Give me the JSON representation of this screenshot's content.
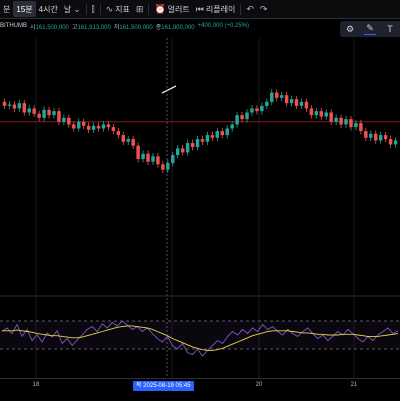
{
  "toolbar": {
    "items": [
      {
        "label": "분",
        "active": false
      },
      {
        "label": "15분",
        "active": true
      },
      {
        "label": "4시간",
        "active": false
      },
      {
        "label": "날",
        "active": false
      }
    ],
    "candle_icon": "candle-chart-icon",
    "indicators_label": "지표",
    "alerts_label": "얼러트",
    "replay_label": "리플레이"
  },
  "legend": {
    "symbol": "BITHUMB",
    "open_label": "시",
    "open": "161,500,000",
    "high_label": "고",
    "high": "161,913,000",
    "low_label": "저",
    "low": "161,500,000",
    "close_label": "종",
    "close": "161,900,000",
    "change": "+400,000 (+0.25%)"
  },
  "colors": {
    "background": "#000000",
    "up": "#26a69a",
    "down": "#ef5350",
    "grid": "#161a22",
    "price_line": "#8b1a1a",
    "rsi_line": "#7e57c2",
    "rsi_ma": "#e8d44d",
    "crosshair": "#787b86",
    "accent": "#2962ff"
  },
  "time_axis": {
    "ticks": [
      "18",
      "19",
      "20",
      "21"
    ],
    "crosshair_label": "목 2025-08-19   05:45"
  },
  "chart_data": {
    "type": "candlestick",
    "series": [
      {
        "name": "price",
        "values": [
          {
            "t": 1,
            "o": 0.55,
            "c": 0.52
          },
          {
            "t": 2,
            "o": 0.52,
            "c": 0.53
          },
          {
            "t": 3,
            "o": 0.53,
            "c": 0.5
          },
          {
            "t": 4,
            "o": 0.5,
            "c": 0.54
          },
          {
            "t": 5,
            "o": 0.54,
            "c": 0.47
          },
          {
            "t": 6,
            "o": 0.47,
            "c": 0.5
          },
          {
            "t": 7,
            "o": 0.5,
            "c": 0.46
          },
          {
            "t": 8,
            "o": 0.46,
            "c": 0.43
          },
          {
            "t": 9,
            "o": 0.43,
            "c": 0.49
          },
          {
            "t": 10,
            "o": 0.49,
            "c": 0.45
          },
          {
            "t": 11,
            "o": 0.45,
            "c": 0.48
          },
          {
            "t": 12,
            "o": 0.48,
            "c": 0.4
          },
          {
            "t": 13,
            "o": 0.4,
            "c": 0.43
          },
          {
            "t": 14,
            "o": 0.43,
            "c": 0.38
          },
          {
            "t": 15,
            "o": 0.38,
            "c": 0.35
          },
          {
            "t": 16,
            "o": 0.35,
            "c": 0.4
          },
          {
            "t": 17,
            "o": 0.4,
            "c": 0.37
          },
          {
            "t": 18,
            "o": 0.37,
            "c": 0.34
          },
          {
            "t": 19,
            "o": 0.34,
            "c": 0.37
          },
          {
            "t": 20,
            "o": 0.37,
            "c": 0.35
          },
          {
            "t": 21,
            "o": 0.35,
            "c": 0.38
          },
          {
            "t": 22,
            "o": 0.38,
            "c": 0.36
          },
          {
            "t": 23,
            "o": 0.36,
            "c": 0.33
          },
          {
            "t": 24,
            "o": 0.33,
            "c": 0.3
          },
          {
            "t": 25,
            "o": 0.3,
            "c": 0.25
          },
          {
            "t": 26,
            "o": 0.25,
            "c": 0.27
          },
          {
            "t": 27,
            "o": 0.27,
            "c": 0.22
          },
          {
            "t": 28,
            "o": 0.22,
            "c": 0.12
          },
          {
            "t": 29,
            "o": 0.12,
            "c": 0.16
          },
          {
            "t": 30,
            "o": 0.16,
            "c": 0.1
          },
          {
            "t": 31,
            "o": 0.1,
            "c": 0.14
          },
          {
            "t": 32,
            "o": 0.14,
            "c": 0.08
          },
          {
            "t": 33,
            "o": 0.08,
            "c": 0.04
          },
          {
            "t": 34,
            "o": 0.04,
            "c": 0.09
          },
          {
            "t": 35,
            "o": 0.09,
            "c": 0.15
          },
          {
            "t": 36,
            "o": 0.15,
            "c": 0.2
          },
          {
            "t": 37,
            "o": 0.2,
            "c": 0.17
          },
          {
            "t": 38,
            "o": 0.17,
            "c": 0.24
          },
          {
            "t": 39,
            "o": 0.24,
            "c": 0.21
          },
          {
            "t": 40,
            "o": 0.21,
            "c": 0.27
          },
          {
            "t": 41,
            "o": 0.27,
            "c": 0.25
          },
          {
            "t": 42,
            "o": 0.25,
            "c": 0.3
          },
          {
            "t": 43,
            "o": 0.3,
            "c": 0.28
          },
          {
            "t": 44,
            "o": 0.28,
            "c": 0.33
          },
          {
            "t": 45,
            "o": 0.33,
            "c": 0.3
          },
          {
            "t": 46,
            "o": 0.3,
            "c": 0.35
          },
          {
            "t": 47,
            "o": 0.35,
            "c": 0.38
          },
          {
            "t": 48,
            "o": 0.38,
            "c": 0.45
          },
          {
            "t": 49,
            "o": 0.45,
            "c": 0.42
          },
          {
            "t": 50,
            "o": 0.42,
            "c": 0.47
          },
          {
            "t": 51,
            "o": 0.47,
            "c": 0.5
          },
          {
            "t": 52,
            "o": 0.5,
            "c": 0.48
          },
          {
            "t": 53,
            "o": 0.48,
            "c": 0.52
          },
          {
            "t": 54,
            "o": 0.52,
            "c": 0.55
          },
          {
            "t": 55,
            "o": 0.55,
            "c": 0.62
          },
          {
            "t": 56,
            "o": 0.62,
            "c": 0.58
          },
          {
            "t": 57,
            "o": 0.58,
            "c": 0.6
          },
          {
            "t": 58,
            "o": 0.6,
            "c": 0.54
          },
          {
            "t": 59,
            "o": 0.54,
            "c": 0.57
          },
          {
            "t": 60,
            "o": 0.57,
            "c": 0.52
          },
          {
            "t": 61,
            "o": 0.52,
            "c": 0.55
          },
          {
            "t": 62,
            "o": 0.55,
            "c": 0.5
          },
          {
            "t": 63,
            "o": 0.5,
            "c": 0.45
          },
          {
            "t": 64,
            "o": 0.45,
            "c": 0.48
          },
          {
            "t": 65,
            "o": 0.48,
            "c": 0.44
          },
          {
            "t": 66,
            "o": 0.44,
            "c": 0.47
          },
          {
            "t": 67,
            "o": 0.47,
            "c": 0.4
          },
          {
            "t": 68,
            "o": 0.4,
            "c": 0.43
          },
          {
            "t": 69,
            "o": 0.43,
            "c": 0.38
          },
          {
            "t": 70,
            "o": 0.38,
            "c": 0.42
          },
          {
            "t": 71,
            "o": 0.42,
            "c": 0.36
          },
          {
            "t": 72,
            "o": 0.36,
            "c": 0.39
          },
          {
            "t": 73,
            "o": 0.39,
            "c": 0.33
          },
          {
            "t": 74,
            "o": 0.33,
            "c": 0.28
          },
          {
            "t": 75,
            "o": 0.28,
            "c": 0.31
          },
          {
            "t": 76,
            "o": 0.31,
            "c": 0.26
          },
          {
            "t": 77,
            "o": 0.26,
            "c": 0.3
          },
          {
            "t": 78,
            "o": 0.3,
            "c": 0.27
          },
          {
            "t": 79,
            "o": 0.27,
            "c": 0.23
          },
          {
            "t": 80,
            "o": 0.23,
            "c": 0.26
          }
        ]
      },
      {
        "name": "rsi",
        "values": [
          55,
          60,
          52,
          65,
          48,
          58,
          42,
          50,
          40,
          53,
          47,
          56,
          38,
          45,
          35,
          43,
          50,
          58,
          62,
          55,
          66,
          60,
          68,
          63,
          70,
          64,
          58,
          62,
          55,
          60,
          52,
          45,
          40,
          48,
          35,
          30,
          38,
          25,
          22,
          30,
          20,
          28,
          35,
          42,
          38,
          48,
          55,
          50,
          58,
          52,
          60,
          55,
          65,
          58,
          62,
          55,
          50,
          58,
          52,
          48,
          55,
          60,
          52,
          45,
          50,
          42,
          48,
          55,
          50,
          58,
          52,
          45,
          40,
          48,
          42,
          50,
          55,
          60,
          52,
          56
        ]
      },
      {
        "name": "rsi_ma",
        "values": [
          56,
          56,
          56,
          57,
          56,
          55,
          54,
          52,
          51,
          50,
          49,
          49,
          48,
          47,
          46,
          46,
          47,
          49,
          51,
          53,
          55,
          57,
          59,
          61,
          62,
          63,
          63,
          62,
          61,
          60,
          58,
          55,
          52,
          49,
          45,
          42,
          39,
          36,
          33,
          31,
          29,
          28,
          28,
          29,
          31,
          34,
          37,
          40,
          43,
          46,
          49,
          51,
          53,
          55,
          56,
          56,
          56,
          56,
          55,
          54,
          53,
          53,
          52,
          51,
          51,
          50,
          50,
          50,
          51,
          51,
          51,
          50,
          49,
          48,
          48,
          48,
          49,
          50,
          51,
          52
        ]
      }
    ],
    "price_line_level": 0.4,
    "rsi_upper_band": 70,
    "rsi_lower_band": 30,
    "ylim": [
      0,
      1
    ]
  }
}
